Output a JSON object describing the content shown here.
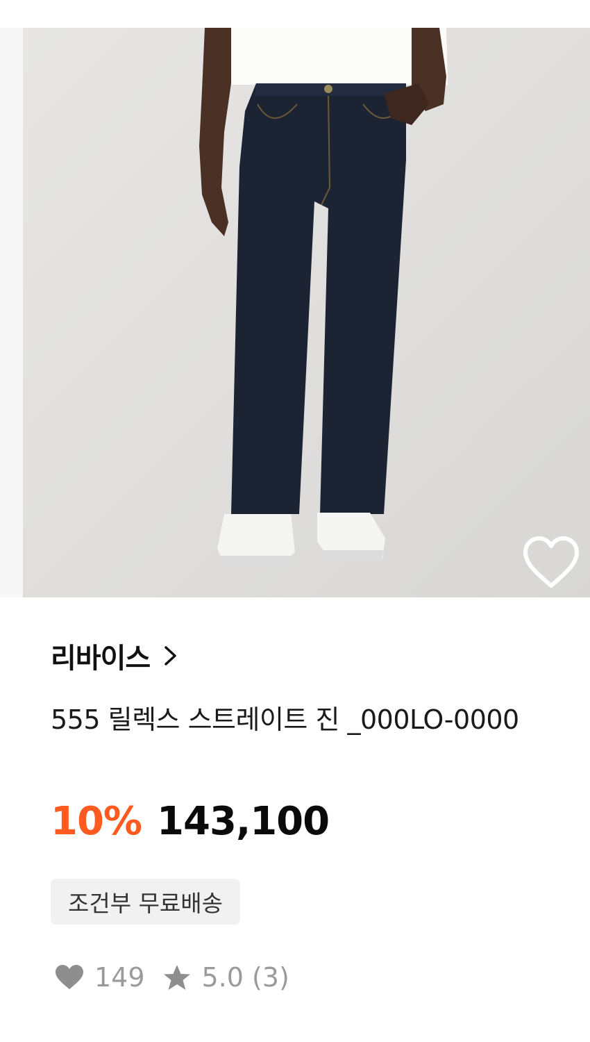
{
  "product": {
    "brand": "리바이스",
    "title": "555 릴렉스 스트레이트 진 _000LO-0000",
    "discount": "10%",
    "price": "143,100",
    "shipping_badge": "조건부 무료배송",
    "likes": "149",
    "rating": "5.0",
    "review_count": "(3)"
  },
  "icons": {
    "brand_arrow": "chevron-right-icon",
    "wishlist": "heart-outline-icon",
    "likes": "heart-filled-icon",
    "rating": "star-icon"
  },
  "colors": {
    "discount": "#ff5a1f",
    "price": "#0a0a0a",
    "badge_bg": "#f1f1f1",
    "stats": "#9a9a9a",
    "jeans": "#1c2434"
  }
}
